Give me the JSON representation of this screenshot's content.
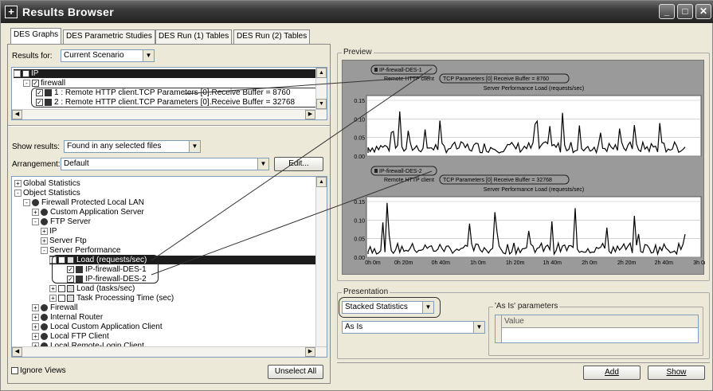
{
  "window": {
    "title": "Results Browser",
    "min": "_",
    "max": "□",
    "close": "✕"
  },
  "tabs": [
    "DES Graphs",
    "DES Parametric Studies",
    "DES Run (1) Tables",
    "DES Run (2) Tables"
  ],
  "results_for": {
    "label": "Results for:",
    "value": "Current Scenario"
  },
  "top_tree": {
    "root": "IP",
    "child": "firewall",
    "items": [
      "1 : Remote HTTP client.TCP Parameters [0].Receive Buffer = 8760",
      "2 : Remote HTTP client.TCP Parameters [0].Receive Buffer = 32768"
    ]
  },
  "show_results": {
    "label": "Show results:",
    "value": "Found in any selected files"
  },
  "arrangement": {
    "label": "Arrangement:",
    "value": "Default",
    "edit_label": "Edit..."
  },
  "stats_tree": [
    {
      "label": "Global Statistics",
      "indent": 0,
      "exp": "+",
      "icon": "none"
    },
    {
      "label": "Object Statistics",
      "indent": 0,
      "exp": "-",
      "icon": "none"
    },
    {
      "label": "Firewall Protected Local LAN",
      "indent": 1,
      "exp": "-",
      "icon": "dot"
    },
    {
      "label": "Custom Application Server",
      "indent": 2,
      "exp": "+",
      "icon": "dot"
    },
    {
      "label": "FTP Server",
      "indent": 2,
      "exp": "-",
      "icon": "dot"
    },
    {
      "label": "IP",
      "indent": 3,
      "exp": "+",
      "icon": "none"
    },
    {
      "label": "Server Ftp",
      "indent": 3,
      "exp": "+",
      "icon": "none"
    },
    {
      "label": "Server Performance",
      "indent": 3,
      "exp": "-",
      "icon": "none"
    },
    {
      "label": "Load (requests/sec)",
      "indent": 4,
      "exp": "-",
      "icon": "chk",
      "selected": true
    },
    {
      "label": "IP-firewall-DES-1",
      "indent": 5,
      "exp": "",
      "icon": "chkdark"
    },
    {
      "label": "IP-firewall-DES-2",
      "indent": 5,
      "exp": "",
      "icon": "chkdark"
    },
    {
      "label": "Load (tasks/sec)",
      "indent": 4,
      "exp": "+",
      "icon": "chk"
    },
    {
      "label": "Task Processing Time (sec)",
      "indent": 4,
      "exp": "+",
      "icon": "chk"
    },
    {
      "label": "Firewall",
      "indent": 2,
      "exp": "+",
      "icon": "dot"
    },
    {
      "label": "Internal Router",
      "indent": 2,
      "exp": "+",
      "icon": "dot"
    },
    {
      "label": "Local Custom Application Client",
      "indent": 2,
      "exp": "+",
      "icon": "dot"
    },
    {
      "label": "Local FTP Client",
      "indent": 2,
      "exp": "+",
      "icon": "dot"
    },
    {
      "label": "Local Remote-Login Client",
      "indent": 2,
      "exp": "+",
      "icon": "dot"
    }
  ],
  "ignore_views": "Ignore Views",
  "unselect_all": "Unselect All",
  "preview": {
    "caption": "Preview",
    "graphs": [
      {
        "series": "IP-firewall-DES-1",
        "param_prefix": "Remote HTTP client",
        "param": "TCP Parameters [0] Receive Buffer = 8760",
        "title": "Server Performance Load (requests/sec)",
        "yticks": [
          "0.15",
          "0.10",
          "0.05",
          "0.00"
        ]
      },
      {
        "series": "IP-firewall-DES-2",
        "param_prefix": "Remote HTTP client",
        "param": "TCP Parameters [0] Receive Buffer = 32768",
        "title": "Server Performance Load (requests/sec)",
        "yticks": [
          "0.15",
          "0.10",
          "0.05",
          "0.00"
        ]
      }
    ],
    "xticks": [
      "0h 0m",
      "0h 20m",
      "0h 40m",
      "1h 0m",
      "1h 20m",
      "1h 40m",
      "2h 0m",
      "2h 20m",
      "2h 40m",
      "3h 0m"
    ]
  },
  "presentation": {
    "caption": "Presentation",
    "mode": "Stacked Statistics",
    "filter": "As Is",
    "params_caption": "'As Is' parameters",
    "value_header": "Value"
  },
  "add_label": "Add",
  "show_label": "Show"
}
